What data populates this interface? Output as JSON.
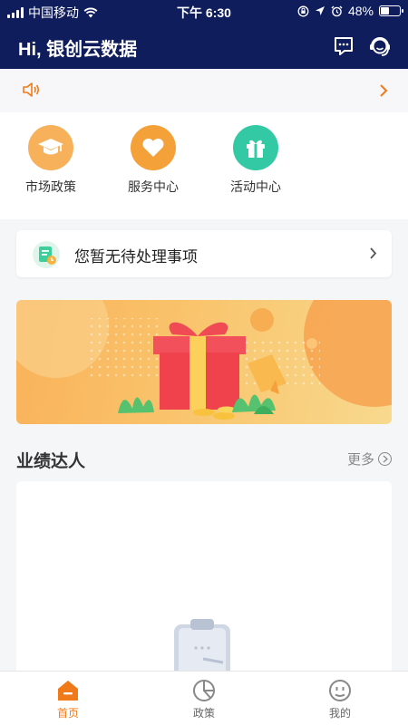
{
  "status_bar": {
    "carrier": "中国移动",
    "time": "下午 6:30",
    "battery_percent": "48%",
    "battery_level": 0.48
  },
  "header": {
    "title": "Hi, 银创云数据",
    "background_color": "#0f1d5c"
  },
  "notice": {
    "icon": "speaker-icon",
    "accent_color": "#f07a1a"
  },
  "quick_links": [
    {
      "label": "市场政策",
      "icon": "graduation-cap-icon",
      "color": "#f6b15a"
    },
    {
      "label": "服务中心",
      "icon": "heart-icon",
      "color": "#f4a13a"
    },
    {
      "label": "活动中心",
      "icon": "gift-icon",
      "color": "#33c9a4"
    }
  ],
  "todo": {
    "text": "您暂无待处理事项"
  },
  "performance": {
    "title": "业绩达人",
    "more_label": "更多"
  },
  "tabbar": {
    "tabs": [
      {
        "label": "首页",
        "icon": "home-icon",
        "active": true
      },
      {
        "label": "政策",
        "icon": "pie-chart-icon",
        "active": false
      },
      {
        "label": "我的",
        "icon": "profile-face-icon",
        "active": false
      }
    ],
    "active_color": "#f07a1a"
  }
}
